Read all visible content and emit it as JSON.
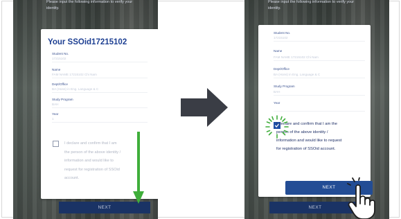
{
  "header_instruction": "Please input the following information to verify your identity.",
  "left_card": {
    "title": "Your SSOid17215102",
    "fields": [
      {
        "label": "Student No.",
        "value": "17215102"
      },
      {
        "label": "Name",
        "value": "FAM NAME 17215102 Chi Nam"
      },
      {
        "label": "Dept/Office",
        "value": "BA (Hons) in Eng. Language & C"
      },
      {
        "label": "Study Program",
        "value": "BAH"
      },
      {
        "label": "Year",
        "value": "1"
      }
    ],
    "declaration": "I declare and confirm that I am the person of the above identity / information and would like to request for registration of SSOid account.",
    "checkbox_checked": false
  },
  "right_card": {
    "fields": [
      {
        "label": "Student No.",
        "value": "17215102"
      },
      {
        "label": "Name",
        "value": "FAM NAME 17215102 Chi Nam"
      },
      {
        "label": "Dept/Office",
        "value": "BA (Hons) in Eng. Language & C"
      },
      {
        "label": "Study Program",
        "value": "BAH"
      },
      {
        "label": "Year",
        "value": ""
      }
    ],
    "declaration": "I declare and confirm that I am the person of the above identity / information and would like to request for registration of SSOid account.",
    "checkbox_checked": true
  },
  "next_label": "NEXT",
  "icons": {
    "transition": "right-arrow-icon",
    "scroll_hint": "green-down-arrow-icon",
    "pointer": "hand-pointer-icon",
    "highlight": "click-burst-icon"
  },
  "colors": {
    "accent": "#1f4fa6",
    "title": "#1d3f92",
    "button": "#234d95",
    "scroll_arrow": "#3fae3a",
    "transition_arrow": "#3a3d45"
  }
}
